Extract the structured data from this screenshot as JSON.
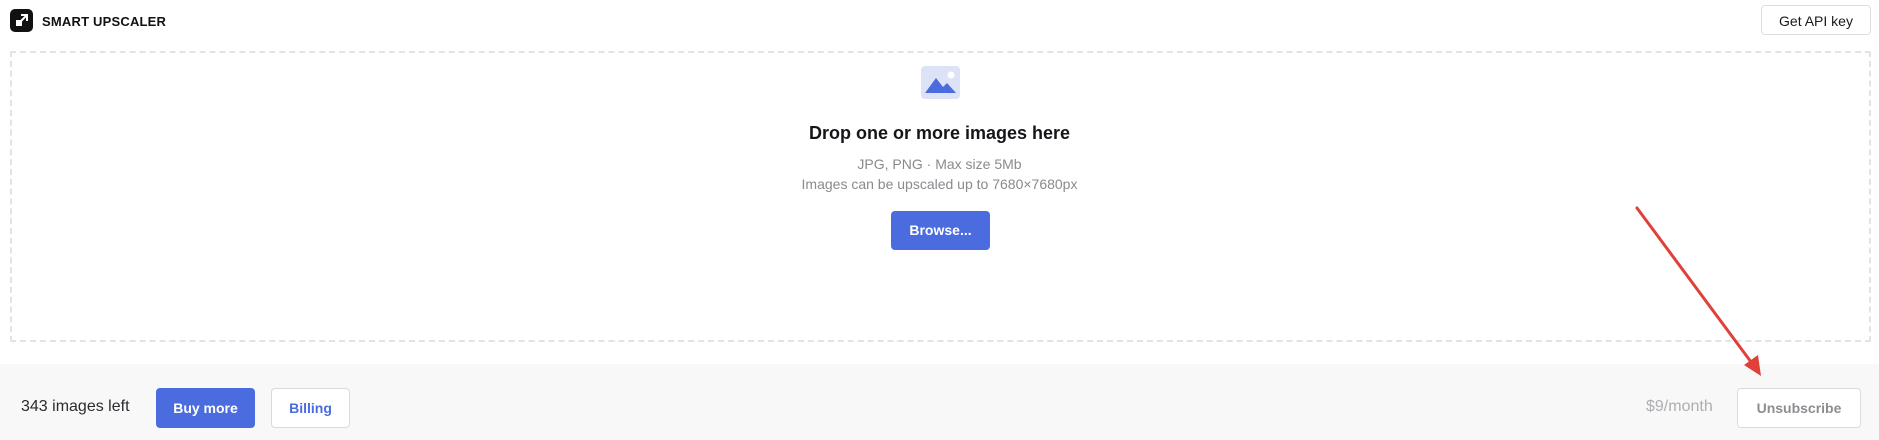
{
  "header": {
    "brand": "SMART UPSCALER",
    "api_button": "Get API key"
  },
  "dropzone": {
    "icon": "image-icon",
    "title": "Drop one or more images here",
    "formats": "JPG, PNG · Max size 5Mb",
    "limit": "Images can be upscaled up to 7680×7680px",
    "browse_button": "Browse..."
  },
  "footer": {
    "images_left": "343 images left",
    "buy_more_button": "Buy more",
    "billing_button": "Billing",
    "price": "$9/month",
    "unsubscribe_button": "Unsubscribe"
  },
  "colors": {
    "accent": "#4a6cde",
    "annotation_arrow": "#e0403a"
  }
}
